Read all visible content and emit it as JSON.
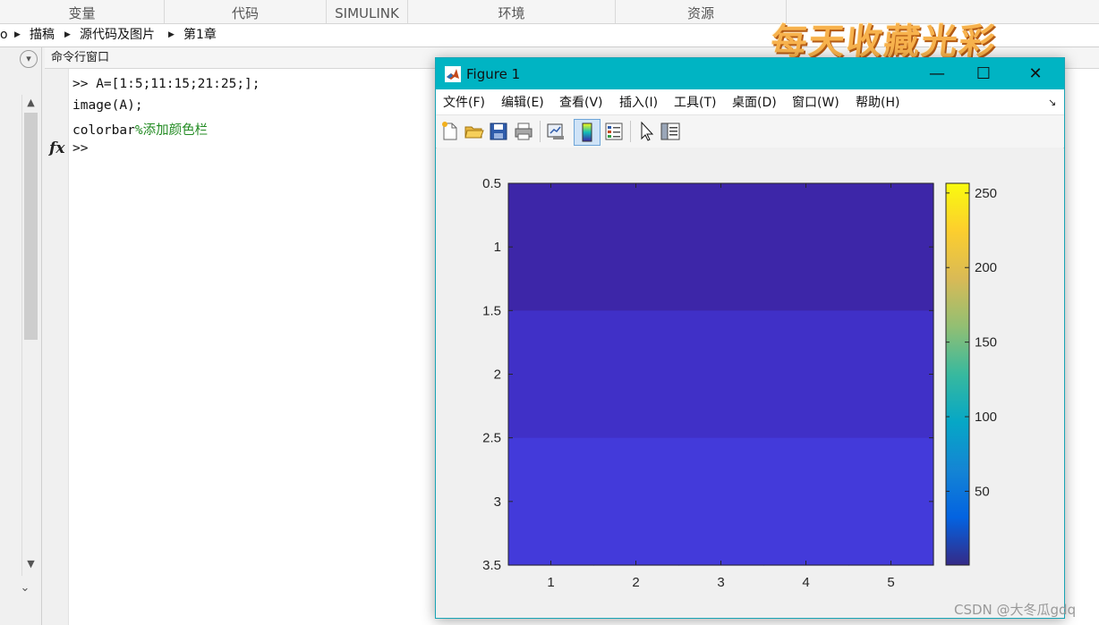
{
  "toolstrip": {
    "tabs": [
      "变量",
      "代码",
      "SIMULINK",
      "环境",
      "资源"
    ]
  },
  "pathbar": {
    "crumbs": [
      "o",
      "描稿",
      "源代码及图片",
      "第1章"
    ]
  },
  "command_window": {
    "title": "命令行窗口",
    "lines": [
      {
        "code": ">> A=[1:5;11:15;21:25;];",
        "comment": ""
      },
      {
        "code": "image(A);",
        "comment": ""
      },
      {
        "code": "colorbar",
        "comment": "%添加颜色栏"
      }
    ],
    "prompt": ">>",
    "fx_label": "fx"
  },
  "figure": {
    "title": "Figure 1",
    "controls": {
      "minimize": "—",
      "maximize": "☐",
      "close": "✕"
    },
    "menus": [
      "文件(F)",
      "编辑(E)",
      "查看(V)",
      "插入(I)",
      "工具(T)",
      "桌面(D)",
      "窗口(W)",
      "帮助(H)"
    ],
    "toolbar_icons": [
      "new-file-icon",
      "open-folder-icon",
      "save-icon",
      "print-icon",
      "link-plot-icon",
      "colorbar-icon",
      "legend-icon",
      "pointer-icon",
      "property-inspector-icon"
    ]
  },
  "chart_data": {
    "type": "heatmap",
    "matrix": [
      [
        1,
        2,
        3,
        4,
        5
      ],
      [
        11,
        12,
        13,
        14,
        15
      ],
      [
        21,
        22,
        23,
        24,
        25
      ]
    ],
    "row_colors": [
      "#3d26a8",
      "#4030c7",
      "#433ada"
    ],
    "x_ticks": [
      1,
      2,
      3,
      4,
      5
    ],
    "y_ticks": [
      0.5,
      1,
      1.5,
      2,
      2.5,
      3,
      3.5
    ],
    "y_tick_labels": [
      "0.5",
      "1",
      "1.5",
      "2",
      "2.5",
      "3",
      "3.5"
    ],
    "xlim": [
      0.5,
      5.5
    ],
    "ylim": [
      0.5,
      3.5
    ],
    "y_direction": "reverse",
    "colorbar": {
      "range": [
        1,
        256
      ],
      "ticks": [
        50,
        100,
        150,
        200,
        250
      ],
      "colormap": "parula",
      "placement": "right"
    },
    "title": "",
    "xlabel": "",
    "ylabel": ""
  },
  "watermarks": {
    "title": "每天收藏光彩",
    "credit": "CSDN @大冬瓜gdq"
  }
}
